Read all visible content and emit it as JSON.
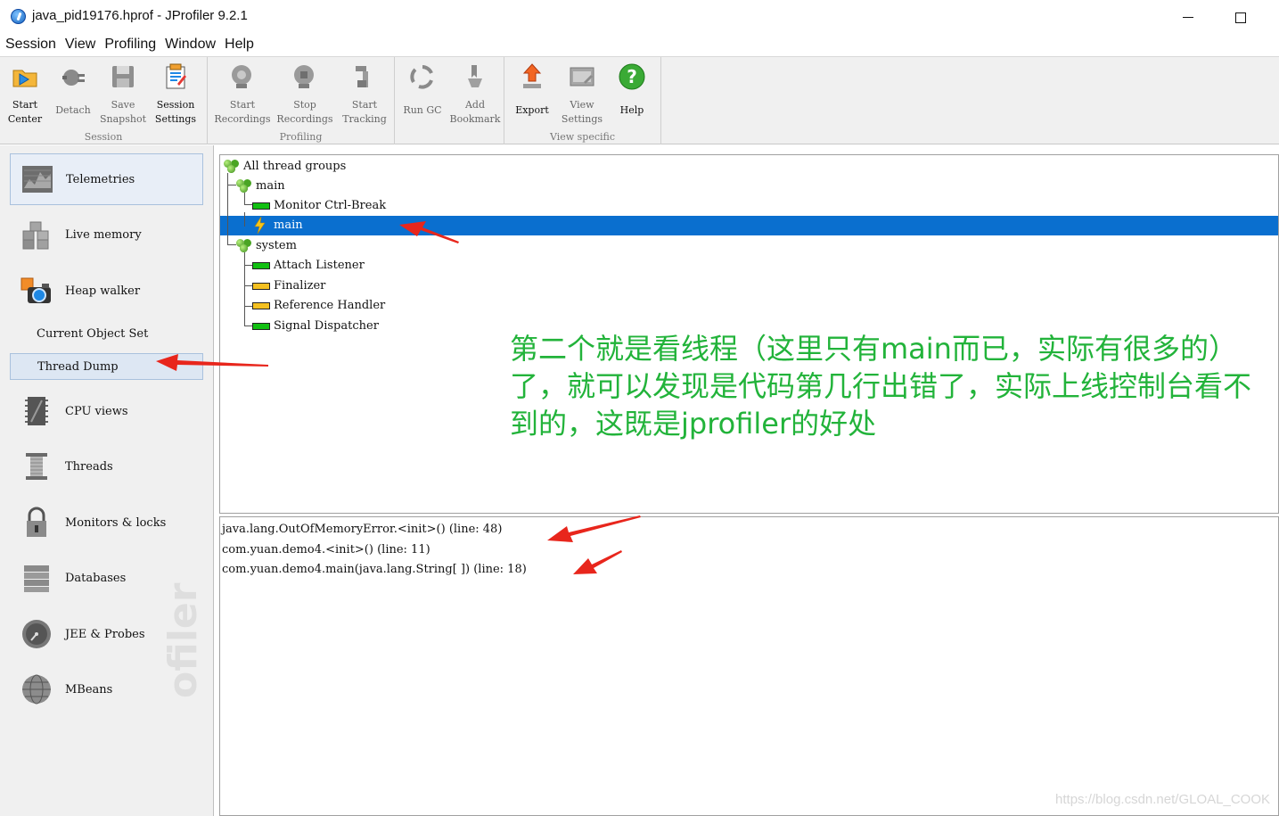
{
  "window": {
    "title": "java_pid19176.hprof - JProfiler 9.2.1"
  },
  "menu": [
    "Session",
    "View",
    "Profiling",
    "Window",
    "Help"
  ],
  "toolbar": {
    "groups": [
      {
        "label": "Session",
        "buttons": [
          {
            "label": "Start\nCenter",
            "icon": "folder-start-icon"
          },
          {
            "label": "Detach",
            "icon": "plug-icon"
          },
          {
            "label": "Save\nSnapshot",
            "icon": "disk-icon"
          },
          {
            "label": "Session\nSettings",
            "icon": "settings-sheet-icon"
          }
        ]
      },
      {
        "label": "Profiling",
        "buttons": [
          {
            "label": "Start\nRecordings",
            "icon": "start-recording-icon"
          },
          {
            "label": "Stop\nRecordings",
            "icon": "stop-recording-icon"
          },
          {
            "label": "Start\nTracking",
            "icon": "tracking-icon"
          }
        ]
      },
      {
        "label": "",
        "buttons": [
          {
            "label": "Run GC",
            "icon": "recycle-icon"
          },
          {
            "label": "Add\nBookmark",
            "icon": "bookmark-icon"
          }
        ]
      },
      {
        "label": "View specific",
        "buttons": [
          {
            "label": "Export",
            "icon": "export-icon"
          },
          {
            "label": "View\nSettings",
            "icon": "view-settings-icon"
          },
          {
            "label": "Help",
            "icon": "help-icon"
          }
        ]
      }
    ]
  },
  "sidebar": {
    "items": [
      {
        "label": "Telemetries",
        "icon": "telemetries-icon"
      },
      {
        "label": "Live memory",
        "icon": "live-memory-icon"
      },
      {
        "label": "Heap walker",
        "icon": "heap-walker-icon"
      },
      {
        "label": "CPU views",
        "icon": "cpu-icon"
      },
      {
        "label": "Threads",
        "icon": "threads-icon"
      },
      {
        "label": "Monitors & locks",
        "icon": "lock-icon"
      },
      {
        "label": "Databases",
        "icon": "database-icon"
      },
      {
        "label": "JEE & Probes",
        "icon": "gauge-icon"
      },
      {
        "label": "MBeans",
        "icon": "globe-icon"
      }
    ],
    "subitems": [
      {
        "label": "Current Object Set"
      },
      {
        "label": "Thread Dump"
      }
    ],
    "watermark": "ofiler"
  },
  "thread_tree": {
    "root": "All thread groups",
    "groups": [
      {
        "name": "main",
        "threads": [
          {
            "name": "Monitor Ctrl-Break",
            "state": "green"
          },
          {
            "name": "main",
            "state": "bolt",
            "selected": true
          }
        ]
      },
      {
        "name": "system",
        "threads": [
          {
            "name": "Attach Listener",
            "state": "green"
          },
          {
            "name": "Finalizer",
            "state": "yellow"
          },
          {
            "name": "Reference Handler",
            "state": "yellow"
          },
          {
            "name": "Signal Dispatcher",
            "state": "green"
          }
        ]
      }
    ],
    "colors": {
      "selection": "#0a6fcf",
      "running": "#12c012",
      "waiting": "#f4c020"
    }
  },
  "stack_trace": [
    "java.lang.OutOfMemoryError.<init>() (line: 48)",
    "com.yuan.demo4.<init>() (line: 11)",
    "com.yuan.demo4.main(java.lang.String[ ]) (line: 18)"
  ],
  "annotation": {
    "text": "第二个就是看线程（这里只有main而已，实际有很多的）了，就可以发现是代码第几行出错了，实际上线控制台看不到的，这既是jprofiler的好处",
    "color": "#22b33a",
    "arrow_color": "#e8261c"
  },
  "watermark": "https://blog.csdn.net/GLOAL_COOK"
}
